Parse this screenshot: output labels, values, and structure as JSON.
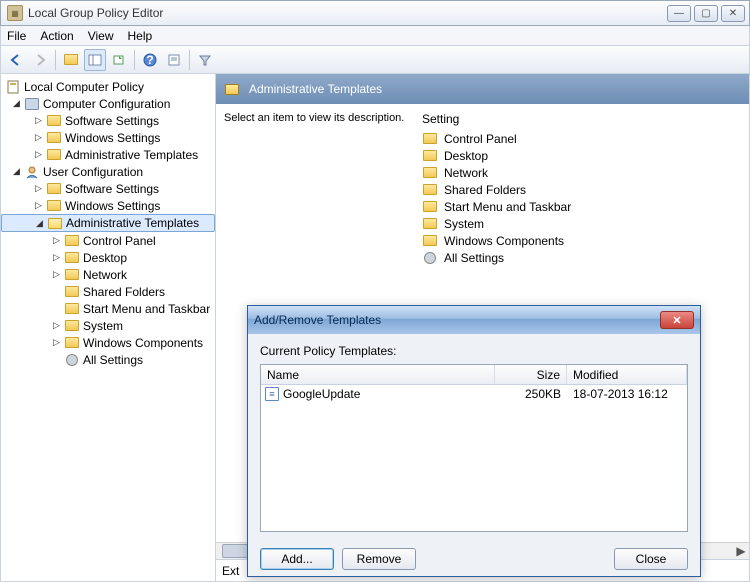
{
  "window": {
    "title": "Local Group Policy Editor",
    "menus": [
      "File",
      "Action",
      "View",
      "Help"
    ]
  },
  "tree": {
    "root": "Local Computer Policy",
    "computer_cfg": "Computer Configuration",
    "user_cfg": "User Configuration",
    "items": {
      "software": "Software Settings",
      "windows": "Windows Settings",
      "admin": "Administrative Templates",
      "cpanel": "Control Panel",
      "desktop": "Desktop",
      "network": "Network",
      "shared": "Shared Folders",
      "startmenu": "Start Menu and Taskbar",
      "system": "System",
      "wincon": "Windows Components",
      "allset": "All Settings"
    }
  },
  "right": {
    "header": "Administrative Templates",
    "prompt": "Select an item to view its description.",
    "col_setting": "Setting",
    "settings": [
      "Control Panel",
      "Desktop",
      "Network",
      "Shared Folders",
      "Start Menu and Taskbar",
      "System",
      "Windows Components",
      "All Settings"
    ],
    "tab_visible": "Ext"
  },
  "dialog": {
    "title": "Add/Remove Templates",
    "label": "Current Policy Templates:",
    "cols": {
      "name": "Name",
      "size": "Size",
      "modified": "Modified"
    },
    "rows": [
      {
        "name": "GoogleUpdate",
        "size": "250KB",
        "modified": "18-07-2013 16:12"
      }
    ],
    "buttons": {
      "add": "Add...",
      "remove": "Remove",
      "close": "Close"
    }
  }
}
